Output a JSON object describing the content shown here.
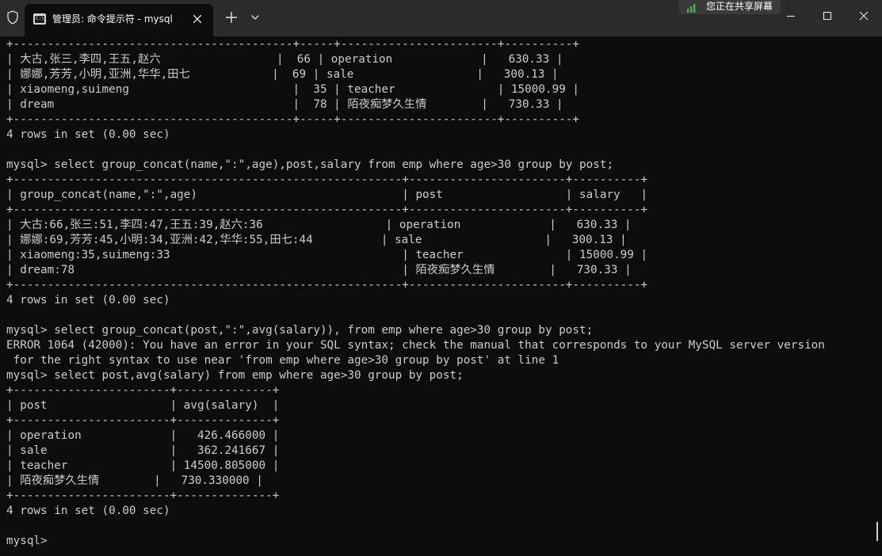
{
  "window": {
    "shield_icon": "shield-icon",
    "tab": {
      "icon": "terminal-icon",
      "icon_text": "C:\\",
      "title": "管理员: 命令提示符 - mysql",
      "close_icon": "close-icon"
    },
    "new_tab_icon": "plus-icon",
    "dropdown_icon": "chevron-down-icon",
    "share_indicator": {
      "icon": "bars-icon",
      "label": "您正在共享屏幕",
      "accent": "#3fb950"
    },
    "controls": [
      "minimize-icon",
      "maximize-icon",
      "close-icon"
    ]
  },
  "terminal": {
    "colors": {
      "background": "#0c0c0c",
      "foreground": "#cccccc",
      "titlebar": "#2b2b2b"
    },
    "lines": [
      "+-----------------------------------------+-----+-----------------------+----------+",
      "| 大古,张三,李四,王五,赵六                 |  66 | operation             |   630.33 |",
      "| 娜娜,芳芳,小明,亚洲,华华,田七            |  69 | sale                  |   300.13 |",
      "| xiaomeng,suimeng                        |  35 | teacher               | 15000.99 |",
      "| dream                                   |  78 | 陌夜痴梦久生情        |   730.33 |",
      "+-----------------------------------------+-----+-----------------------+----------+",
      "4 rows in set (0.00 sec)",
      "",
      "mysql> select group_concat(name,\":\",age),post,salary from emp where age>30 group by post;",
      "+---------------------------------------------------------+-----------------------+----------+",
      "| group_concat(name,\":\",age)                              | post                  | salary   |",
      "+---------------------------------------------------------+-----------------------+----------+",
      "| 大古:66,张三:51,李四:47,王五:39,赵六:36                  | operation             |   630.33 |",
      "| 娜娜:69,芳芳:45,小明:34,亚洲:42,华华:55,田七:44          | sale                  |   300.13 |",
      "| xiaomeng:35,suimeng:33                                  | teacher               | 15000.99 |",
      "| dream:78                                                | 陌夜痴梦久生情        |   730.33 |",
      "+---------------------------------------------------------+-----------------------+----------+",
      "4 rows in set (0.00 sec)",
      "",
      "mysql> select group_concat(post,\":\",avg(salary)), from emp where age>30 group by post;",
      "ERROR 1064 (42000): You have an error in your SQL syntax; check the manual that corresponds to your MySQL server version",
      " for the right syntax to use near 'from emp where age>30 group by post' at line 1",
      "mysql> select post,avg(salary) from emp where age>30 group by post;",
      "+-----------------------+--------------+",
      "| post                  | avg(salary)  |",
      "+-----------------------+--------------+",
      "| operation             |   426.466000 |",
      "| sale                  |   362.241667 |",
      "| teacher               | 14500.805000 |",
      "| 陌夜痴梦久生情        |   730.330000 |",
      "+-----------------------+--------------+",
      "4 rows in set (0.00 sec)",
      "",
      "mysql> "
    ]
  }
}
